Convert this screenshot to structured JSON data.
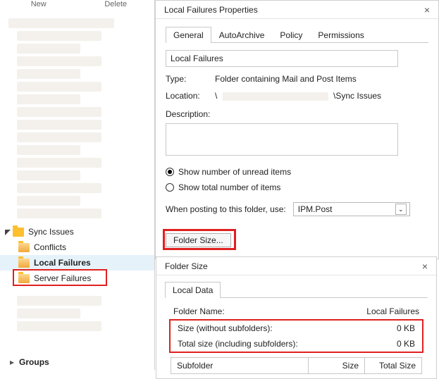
{
  "top": {
    "new": "New",
    "delete": "Delete"
  },
  "tree": {
    "parent": "Sync Issues",
    "items": [
      {
        "label": "Conflicts"
      },
      {
        "label": "Local Failures"
      },
      {
        "label": "Server Failures"
      }
    ]
  },
  "groups_label": "Groups",
  "dialog": {
    "title": "Local Failures Properties",
    "tabs": [
      "General",
      "AutoArchive",
      "Policy",
      "Permissions"
    ],
    "folder_name": "Local Failures",
    "type_label": "Type:",
    "type_value": "Folder containing Mail and Post Items",
    "location_label": "Location:",
    "location_prefix": "\\",
    "location_suffix": "\\Sync Issues",
    "description_label": "Description:",
    "radio_unread": "Show number of unread items",
    "radio_total": "Show total number of items",
    "posting_label": "When posting to this folder, use:",
    "posting_value": "IPM.Post",
    "folder_size_btn": "Folder Size..."
  },
  "dialog2": {
    "title": "Folder Size",
    "tab": "Local Data",
    "folder_name_label": "Folder Name:",
    "folder_name_value": "Local Failures",
    "size_wo_label": "Size (without subfolders):",
    "size_wo_value": "0 KB",
    "size_total_label": "Total size (including subfolders):",
    "size_total_value": "0 KB",
    "col_sub": "Subfolder",
    "col_size": "Size",
    "col_total": "Total Size"
  }
}
